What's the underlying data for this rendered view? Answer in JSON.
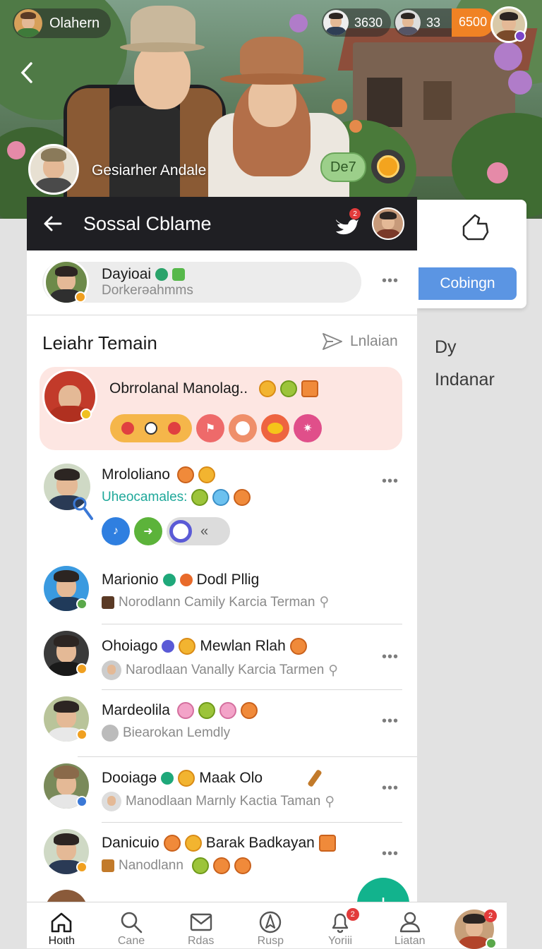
{
  "hero": {
    "user_chip": "Olahern",
    "stat1": "3630",
    "stat2": "33",
    "stat3": "6500",
    "caption": "Gesiarher Andale",
    "tag": "De7"
  },
  "header": {
    "title": "Sossal Cblame",
    "notif_count": "2"
  },
  "profile_card": {
    "name": "Dayioai",
    "sub": "Dorkerǝahmms"
  },
  "side_panel": {
    "button_label": "Cobingn",
    "text1": "Dy",
    "text2": "Indanar"
  },
  "section": {
    "title": "Leiahr Temain",
    "action": "Lnlaian"
  },
  "featured": {
    "name": "Obrrolanal Manolag.."
  },
  "items": [
    {
      "name": "Mrololiano",
      "sub": "Uheocamales:"
    },
    {
      "name": "Marionio",
      "name2": "Dodl Pllig",
      "sub": "Norodlann Camily Karcia Terman"
    },
    {
      "name": "Ohoiago",
      "name2": "Mewlan Rlah",
      "sub": "Narodlaan Vanally Karcia Tarmen"
    },
    {
      "name": "Mardeolila",
      "sub": "Biearokan Lemdly"
    },
    {
      "name": "Dooiagǝ",
      "name2": "Maak Olo",
      "sub": "Manodlaan Marnly Kactia Taman"
    },
    {
      "name": "Danicuio",
      "name2": "Barak Badkayan",
      "sub": "Nanodlann"
    }
  ],
  "nav": [
    {
      "label": "Hoιth",
      "icon": "home-icon"
    },
    {
      "label": "Cane",
      "icon": "search-icon"
    },
    {
      "label": "Rdas",
      "icon": "mail-icon"
    },
    {
      "label": "Rusp",
      "icon": "compass-icon"
    },
    {
      "label": "Yoriii",
      "icon": "bell-icon",
      "badge": "2"
    },
    {
      "label": "Liatan",
      "icon": "person-icon"
    }
  ],
  "nav_avatar_badge": "2",
  "colors": {
    "accent": "#5b95e3",
    "header_bg": "#1f1f23",
    "featured_bg": "#fde6e2"
  }
}
